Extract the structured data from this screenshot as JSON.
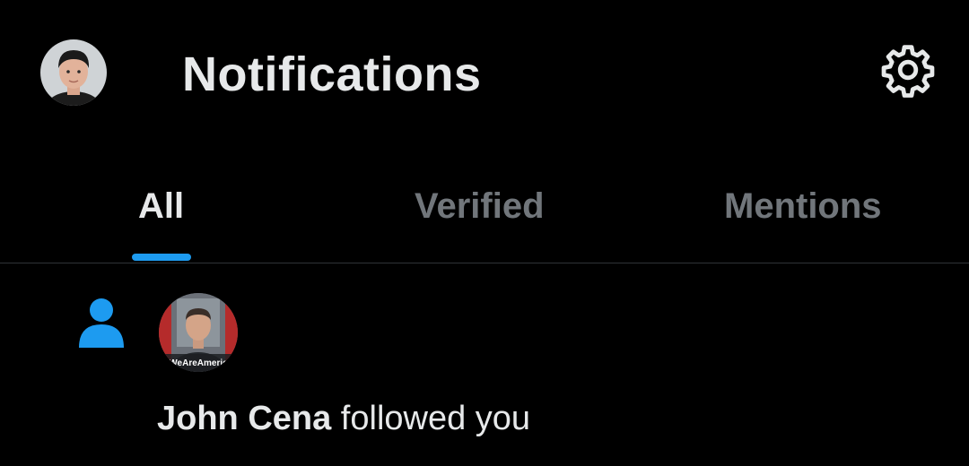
{
  "header": {
    "title": "Notifications",
    "avatar_icon": "user-avatar",
    "settings_icon": "gear-icon"
  },
  "tabs": [
    {
      "label": "All",
      "active": true
    },
    {
      "label": "Verified",
      "active": false
    },
    {
      "label": "Mentions",
      "active": false
    }
  ],
  "notifications": [
    {
      "type_icon": "person-icon",
      "avatar_overlay_text": "#WeAreAmerica",
      "user_name": "John Cena",
      "action_text": " followed you"
    }
  ],
  "colors": {
    "background": "#000000",
    "text_primary": "#e7e9ea",
    "text_secondary": "#71767b",
    "accent": "#1d9bf0",
    "divider": "#2f3336"
  }
}
